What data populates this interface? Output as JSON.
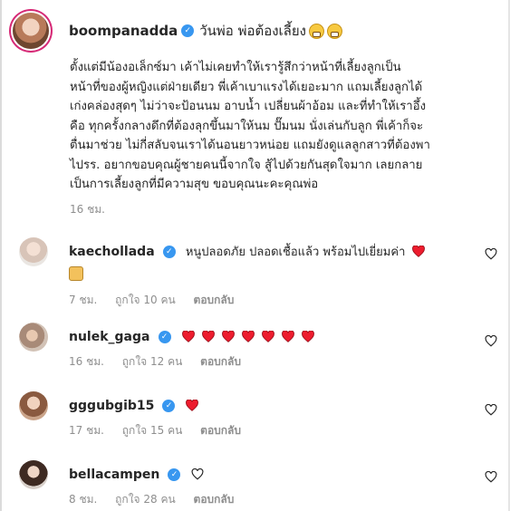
{
  "post": {
    "username": "boompanadda",
    "headline": "วันพ่อ พ่อต้องเลี้ยง",
    "caption": "ตั้งแต่มีน้องอเล็กซ์มา เค้าไม่เคยทำให้เรารู้สึกว่าหน้าที่เลี้ยงลูกเป็น\nหน้าที่ของผู้หญิงแต่ฝ่ายเดียว พี่เค้าเบาแรงได้เยอะมาก แถมเลี้ยงลูกได้\nเก่งคล่องสุดๆ ไม่ว่าจะป้อนนม อาบน้ำ เปลี่ยนผ้าอ้อม และที่ทำให้เราอึ้ง\nคือ ทุกครั้งกลางดึกที่ต้องลุกขึ้นมาให้นม ปั๊มนม นั่งเล่นกับลูก พี่เค้าก็จะ\nตื่นมาช่วย ไม่กี่สลับจนเราได้นอนยาวหน่อย แถมยังดูแลลูกสาวที่ต้องพา\nไปรร. อยากขอบคุณผู้ชายคนนี้จากใจ สู้ไปด้วยกันสุดใจมาก เลยกลาย\nเป็นการเลี้ยงลูกที่มีความสุข ขอบคุณนะคะคุณพ่อ",
    "time": "16 ชม."
  },
  "comments": [
    {
      "username": "kaechollada",
      "text": "หนูปลอดภัย ปลอดเชื้อแล้ว พร้อมไปเยี่ยมค่า",
      "time": "7 ชม.",
      "likes": "ถูกใจ 10 คน",
      "reply": "ตอบกลับ"
    },
    {
      "username": "nulek_gaga",
      "text": "",
      "time": "16 ชม.",
      "likes": "ถูกใจ 12 คน",
      "reply": "ตอบกลับ"
    },
    {
      "username": "gggubgib15",
      "text": "",
      "time": "17 ชม.",
      "likes": "ถูกใจ 15 คน",
      "reply": "ตอบกลับ"
    },
    {
      "username": "bellacampen",
      "text": "",
      "time": "8 ชม.",
      "likes": "ถูกใจ 28 คน",
      "reply": "ตอบกลับ"
    }
  ],
  "icons": {
    "verified": "verified-badge-icon",
    "like": "heart-outline-icon",
    "red_heart": "red-heart-emoji"
  },
  "colors": {
    "verified": "#3897f0",
    "heart": "#ed4956",
    "muted": "#8e8e8e",
    "story_ring": "#d62976"
  }
}
